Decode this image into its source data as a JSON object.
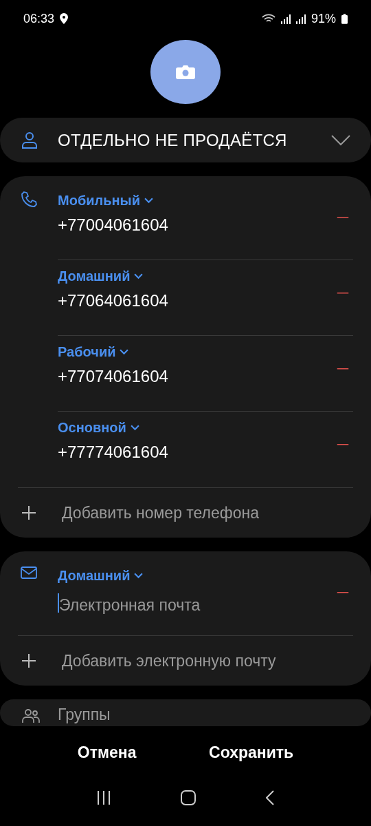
{
  "status_bar": {
    "time": "06:33",
    "battery": "91%"
  },
  "name": {
    "value": "ОТДЕЛЬНО НЕ ПРОДАЁТСЯ",
    "expanded": false
  },
  "phones": [
    {
      "label": "Мобильный",
      "number": "+77004061604"
    },
    {
      "label": "Домашний",
      "number": "+77064061604"
    },
    {
      "label": "Рабочий",
      "number": "+77074061604"
    },
    {
      "label": "Основной",
      "number": "+77774061604"
    }
  ],
  "add_phone": "Добавить номер телефона",
  "emails": [
    {
      "label": "Домашний",
      "placeholder": "Электронная почта",
      "focused": true
    }
  ],
  "add_email": "Добавить электронную почту",
  "groups": "Группы",
  "buttons": [
    "Отмена",
    "Сохранить"
  ]
}
